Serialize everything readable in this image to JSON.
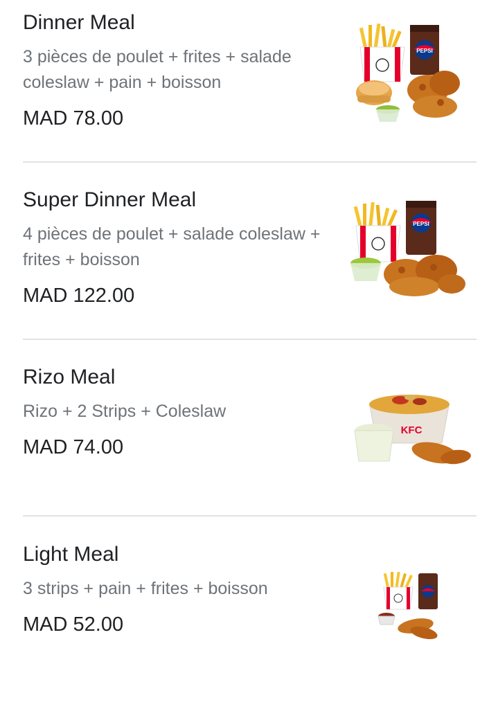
{
  "menu": {
    "items": [
      {
        "name": "Dinner Meal",
        "description": "3 pièces de poulet + frites + salade coleslaw + pain + boisson",
        "price": "MAD 78.00",
        "image": "dinner-meal-photo"
      },
      {
        "name": "Super Dinner Meal",
        "description": "4 pièces de poulet + salade coleslaw + frites + boisson",
        "price": "MAD 122.00",
        "image": "super-dinner-meal-photo"
      },
      {
        "name": "Rizo Meal",
        "description": "Rizo + 2 Strips + Coleslaw",
        "price": "MAD 74.00",
        "image": "rizo-meal-photo"
      },
      {
        "name": "Light Meal",
        "description": "3 strips + pain + frites + boisson",
        "price": "MAD 52.00",
        "image": "light-meal-photo"
      }
    ]
  },
  "images": {
    "brand_text": "KFC",
    "drink_text": "PEPSI"
  },
  "colors": {
    "brand_red": "#e4002b",
    "pepsi_blue": "#0b3a8c",
    "fries_yellow": "#f5c431",
    "chicken": "#c8731f"
  }
}
